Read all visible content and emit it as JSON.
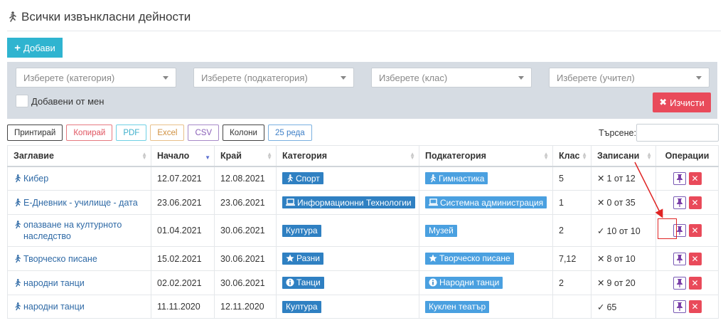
{
  "page": {
    "title": "Всички извънкласни дейности"
  },
  "toolbar": {
    "add_label": "Добави"
  },
  "filters": {
    "category_placeholder": "Изберете (категория)",
    "subcategory_placeholder": "Изберете (подкатегория)",
    "class_placeholder": "Изберете (клас)",
    "teacher_placeholder": "Изберете (учител)",
    "mine_label": "Добавени от мен",
    "clear_label": "Изчисти"
  },
  "export": {
    "print": "Принтирай",
    "copy": "Копирай",
    "pdf": "PDF",
    "excel": "Excel",
    "csv": "CSV",
    "columns": "Колони",
    "rows": "25 реда"
  },
  "search": {
    "label": "Търсене:"
  },
  "table": {
    "headers": [
      "Заглавие",
      "Начало",
      "Край",
      "Категория",
      "Подкатегория",
      "Клас",
      "Записани",
      "Операции"
    ],
    "rows": [
      {
        "title": "Кибер",
        "start": "12.07.2021",
        "end": "12.08.2021",
        "category": "Спорт",
        "category_icon": "running-icon",
        "subcategory": "Гимнастика",
        "subcategory_icon": "running-icon",
        "class": "5",
        "enrolled": "1 от 12",
        "enrolled_mark": "✕"
      },
      {
        "title": "Е-Дневник - училище - дата",
        "start": "23.06.2021",
        "end": "23.06.2021",
        "category": "Информационни Технологии",
        "category_icon": "laptop-icon",
        "subcategory": "Системна администрация",
        "subcategory_icon": "laptop-icon",
        "class": "1",
        "enrolled": "0 от 35",
        "enrolled_mark": "✕"
      },
      {
        "title": "опазване на културното наследство",
        "start": "01.04.2021",
        "end": "30.06.2021",
        "category": "Култура",
        "category_icon": "",
        "subcategory": "Музей",
        "subcategory_icon": "",
        "class": "2",
        "enrolled": "10 от 10",
        "enrolled_mark": "✓"
      },
      {
        "title": "Творческо писане",
        "start": "15.02.2021",
        "end": "30.06.2021",
        "category": "Разни",
        "category_icon": "star-icon",
        "subcategory": "Творческо писане",
        "subcategory_icon": "star-icon",
        "class": "7,12",
        "enrolled": "8 от 10",
        "enrolled_mark": "✕"
      },
      {
        "title": "народни танци",
        "start": "02.02.2021",
        "end": "30.06.2021",
        "category": "Танци",
        "category_icon": "info-icon",
        "subcategory": "Народни танци",
        "subcategory_icon": "info-icon",
        "class": "2",
        "enrolled": "9 от 20",
        "enrolled_mark": "✕"
      },
      {
        "title": "народни танци",
        "start": "11.11.2020",
        "end": "12.11.2020",
        "category": "Култура",
        "category_icon": "",
        "subcategory": "Куклен театър",
        "subcategory_icon": "",
        "class": "",
        "enrolled": "65",
        "enrolled_mark": "✓"
      }
    ]
  },
  "colors": {
    "accent": "#2fb4d0",
    "danger": "#e94a5a",
    "badge": "#2f80c2",
    "link": "#2f6aa6",
    "panel": "#d6dce3"
  }
}
